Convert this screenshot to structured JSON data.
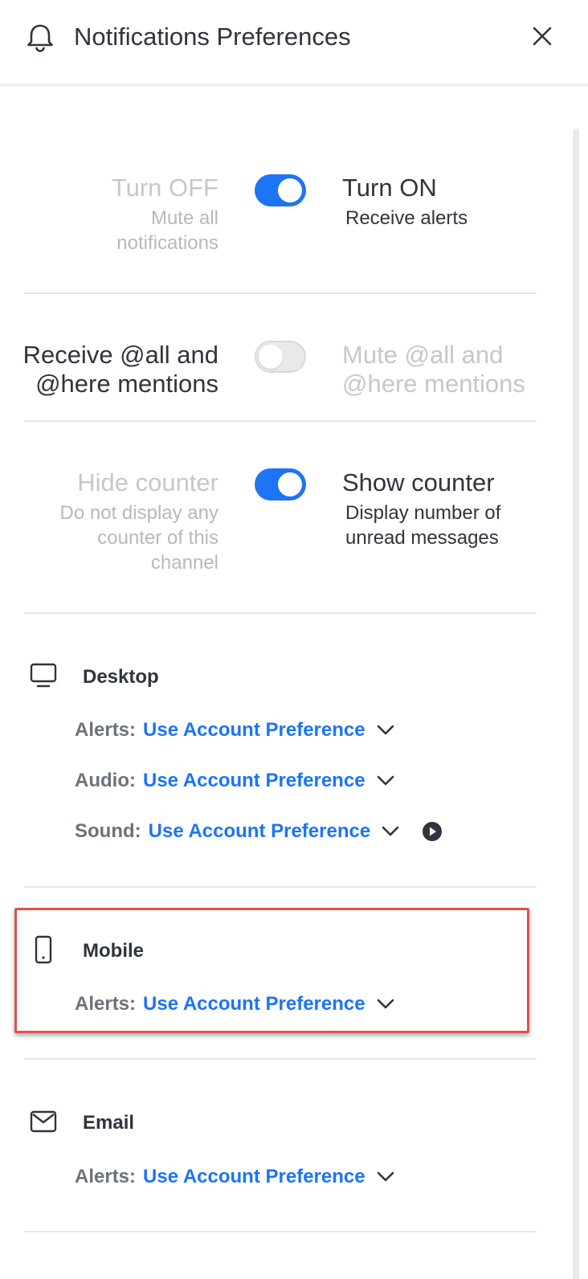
{
  "header": {
    "title": "Notifications Preferences",
    "icon": "bell-icon",
    "close_icon": "close-icon"
  },
  "toggles": [
    {
      "off_label": "Turn OFF",
      "off_sub": "Mute all notifications",
      "on_label": "Turn ON",
      "on_sub": "Receive alerts",
      "state": "on"
    },
    {
      "off_label": "Receive @all and @here mentions",
      "on_label": "Mute @all and @here mentions",
      "state": "off"
    },
    {
      "off_label": "Hide counter",
      "off_sub": "Do not display any counter of this channel",
      "on_label": "Show counter",
      "on_sub": "Display number of unread messages",
      "state": "on"
    }
  ],
  "sections": {
    "desktop": {
      "title": "Desktop",
      "icon": "desktop-icon",
      "rows": [
        {
          "key": "Alerts:",
          "value": "Use Account Preference"
        },
        {
          "key": "Audio:",
          "value": "Use Account Preference"
        },
        {
          "key": "Sound:",
          "value": "Use Account Preference"
        }
      ]
    },
    "mobile": {
      "title": "Mobile",
      "icon": "mobile-icon",
      "rows": [
        {
          "key": "Alerts:",
          "value": "Use Account Preference"
        }
      ]
    },
    "email": {
      "title": "Email",
      "icon": "email-icon",
      "rows": [
        {
          "key": "Alerts:",
          "value": "Use Account Preference"
        }
      ]
    }
  },
  "colors": {
    "accent": "#1d74f5",
    "highlight_border": "#d9534f"
  }
}
